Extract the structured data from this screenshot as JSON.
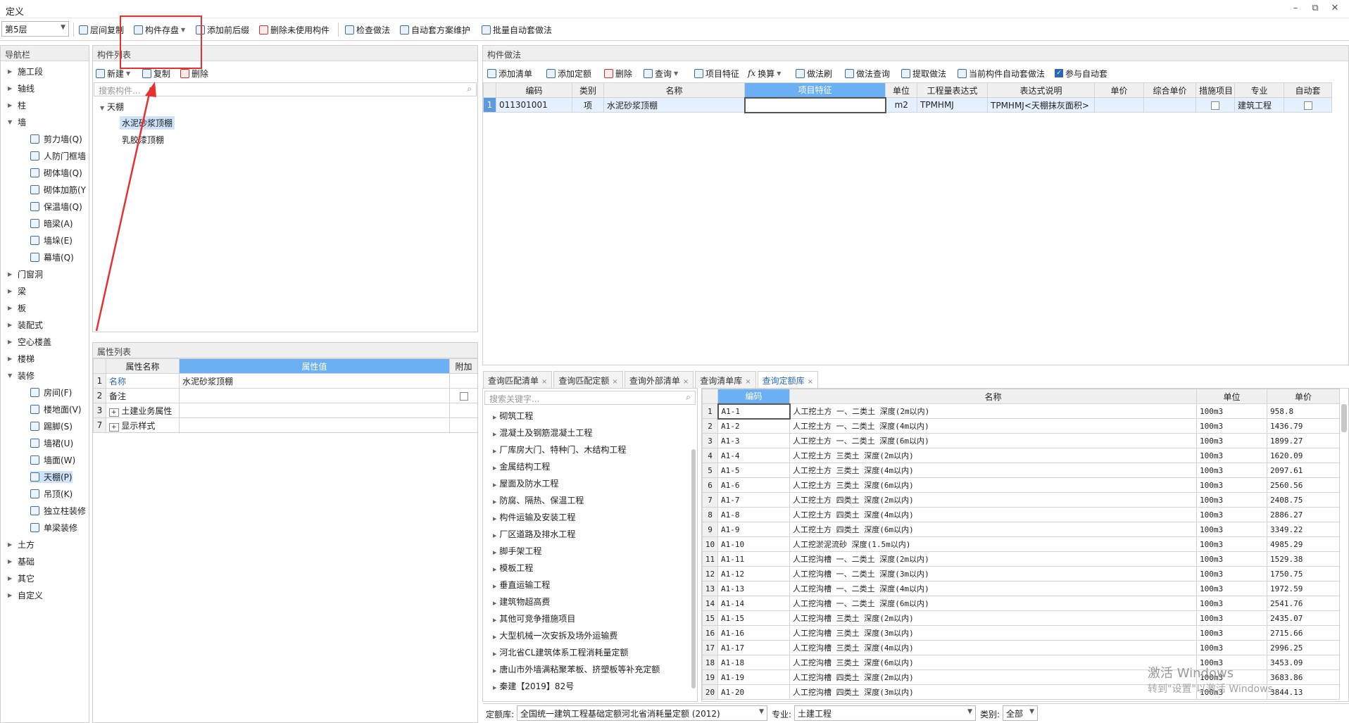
{
  "window": {
    "title": "定义"
  },
  "toolbar": {
    "floor": "第5层",
    "buttons": [
      "层间复制",
      "构件存盘",
      "添加前后缀",
      "删除未使用构件",
      "检查做法",
      "自动套方案维护",
      "批量自动套做法"
    ]
  },
  "nav": {
    "title": "导航栏",
    "items": [
      {
        "label": "施工段",
        "level": 0,
        "expanded": false
      },
      {
        "label": "轴线",
        "level": 0,
        "expanded": false
      },
      {
        "label": "柱",
        "level": 0,
        "expanded": false
      },
      {
        "label": "墙",
        "level": 0,
        "expanded": true
      },
      {
        "label": "剪力墙(Q)",
        "level": 1
      },
      {
        "label": "人防门框墙",
        "level": 1
      },
      {
        "label": "砌体墙(Q)",
        "level": 1
      },
      {
        "label": "砌体加筋(Y",
        "level": 1
      },
      {
        "label": "保温墙(Q)",
        "level": 1
      },
      {
        "label": "暗梁(A)",
        "level": 1
      },
      {
        "label": "墙垛(E)",
        "level": 1
      },
      {
        "label": "幕墙(Q)",
        "level": 1
      },
      {
        "label": "门窗洞",
        "level": 0,
        "expanded": false
      },
      {
        "label": "梁",
        "level": 0,
        "expanded": false
      },
      {
        "label": "板",
        "level": 0,
        "expanded": false
      },
      {
        "label": "装配式",
        "level": 0,
        "expanded": false
      },
      {
        "label": "空心楼盖",
        "level": 0,
        "expanded": false
      },
      {
        "label": "楼梯",
        "level": 0,
        "expanded": false
      },
      {
        "label": "装修",
        "level": 0,
        "expanded": true
      },
      {
        "label": "房间(F)",
        "level": 1
      },
      {
        "label": "楼地面(V)",
        "level": 1
      },
      {
        "label": "踢脚(S)",
        "level": 1
      },
      {
        "label": "墙裙(U)",
        "level": 1
      },
      {
        "label": "墙面(W)",
        "level": 1
      },
      {
        "label": "天棚(P)",
        "level": 1,
        "selected": true
      },
      {
        "label": "吊顶(K)",
        "level": 1
      },
      {
        "label": "独立柱装修",
        "level": 1
      },
      {
        "label": "单梁装修",
        "level": 1
      },
      {
        "label": "土方",
        "level": 0,
        "expanded": false
      },
      {
        "label": "基础",
        "level": 0,
        "expanded": false
      },
      {
        "label": "其它",
        "level": 0,
        "expanded": false
      },
      {
        "label": "自定义",
        "level": 0,
        "expanded": false
      }
    ]
  },
  "component_list": {
    "title": "构件列表",
    "actions": [
      "新建",
      "复制",
      "删除"
    ],
    "search_placeholder": "搜索构件...",
    "group": "天棚",
    "items": [
      "水泥砂浆顶棚",
      "乳胶漆顶棚"
    ]
  },
  "properties": {
    "title": "属性列表",
    "headers": [
      "属性名称",
      "属性值",
      "附加"
    ],
    "rows": [
      {
        "no": "1",
        "name": "名称",
        "value": "水泥砂浆顶棚"
      },
      {
        "no": "2",
        "name": "备注",
        "value": ""
      },
      {
        "no": "3",
        "name": "土建业务属性",
        "value": ""
      },
      {
        "no": "7",
        "name": "显示样式",
        "value": ""
      }
    ]
  },
  "method": {
    "title": "构件做法",
    "actions": [
      "添加清单",
      "添加定额",
      "删除",
      "查询",
      "项目特征",
      "换算",
      "做法刷",
      "做法查询",
      "提取做法",
      "当前构件自动套做法",
      "参与自动套"
    ],
    "headers": [
      "编码",
      "类别",
      "名称",
      "项目特征",
      "单位",
      "工程量表达式",
      "表达式说明",
      "单价",
      "综合单价",
      "措施项目",
      "专业",
      "自动套"
    ],
    "rows": [
      {
        "no": "1",
        "code": "011301001",
        "cat": "项",
        "name": "水泥砂浆顶棚",
        "feature": "",
        "unit": "m2",
        "expr": "TPMHMJ",
        "desc": "TPMHMJ<天棚抹灰面积>",
        "price": "",
        "total": "",
        "specialty": "建筑工程"
      }
    ]
  },
  "query": {
    "tabs": [
      "查询匹配清单",
      "查询匹配定额",
      "查询外部清单",
      "查询清单库",
      "查询定额库"
    ],
    "search_placeholder": "搜索关键字...",
    "categories": [
      "砌筑工程",
      "混凝土及钢筋混凝土工程",
      "厂库房大门、特种门、木结构工程",
      "金属结构工程",
      "屋面及防水工程",
      "防腐、隔热、保温工程",
      "构件运输及安装工程",
      "厂区道路及排水工程",
      "脚手架工程",
      "模板工程",
      "垂直运输工程",
      "建筑物超高费",
      "其他可竞争措施项目",
      "大型机械一次安拆及场外运输费",
      "河北省CL建筑体系工程消耗量定额",
      "唐山市外墙满粘聚苯板、挤塑板等补充定额",
      "秦建【2019】82号"
    ],
    "headers": [
      "编码",
      "名称",
      "单位",
      "单价"
    ],
    "rows": [
      {
        "no": "1",
        "code": "A1-1",
        "name": "人工挖土方 一、二类土 深度(2m以内)",
        "unit": "100m3",
        "price": "958.8"
      },
      {
        "no": "2",
        "code": "A1-2",
        "name": "人工挖土方 一、二类土 深度(4m以内)",
        "unit": "100m3",
        "price": "1436.79"
      },
      {
        "no": "3",
        "code": "A1-3",
        "name": "人工挖土方 一、二类土 深度(6m以内)",
        "unit": "100m3",
        "price": "1899.27"
      },
      {
        "no": "4",
        "code": "A1-4",
        "name": "人工挖土方 三类土 深度(2m以内)",
        "unit": "100m3",
        "price": "1620.09"
      },
      {
        "no": "5",
        "code": "A1-5",
        "name": "人工挖土方 三类土 深度(4m以内)",
        "unit": "100m3",
        "price": "2097.61"
      },
      {
        "no": "6",
        "code": "A1-6",
        "name": "人工挖土方 三类土 深度(6m以内)",
        "unit": "100m3",
        "price": "2560.56"
      },
      {
        "no": "7",
        "code": "A1-7",
        "name": "人工挖土方 四类土 深度(2m以内)",
        "unit": "100m3",
        "price": "2408.75"
      },
      {
        "no": "8",
        "code": "A1-8",
        "name": "人工挖土方 四类土 深度(4m以内)",
        "unit": "100m3",
        "price": "2886.27"
      },
      {
        "no": "9",
        "code": "A1-9",
        "name": "人工挖土方 四类土 深度(6m以内)",
        "unit": "100m3",
        "price": "3349.22"
      },
      {
        "no": "10",
        "code": "A1-10",
        "name": "人工挖淤泥流砂 深度(1.5m以内)",
        "unit": "100m3",
        "price": "4985.29"
      },
      {
        "no": "11",
        "code": "A1-11",
        "name": "人工挖沟槽 一、二类土 深度(2m以内)",
        "unit": "100m3",
        "price": "1529.38"
      },
      {
        "no": "12",
        "code": "A1-12",
        "name": "人工挖沟槽 一、二类土 深度(3m以内)",
        "unit": "100m3",
        "price": "1750.75"
      },
      {
        "no": "13",
        "code": "A1-13",
        "name": "人工挖沟槽 一、二类土 深度(4m以内)",
        "unit": "100m3",
        "price": "1972.59"
      },
      {
        "no": "14",
        "code": "A1-14",
        "name": "人工挖沟槽 一、二类土 深度(6m以内)",
        "unit": "100m3",
        "price": "2541.76"
      },
      {
        "no": "15",
        "code": "A1-15",
        "name": "人工挖沟槽 三类土 深度(2m以内)",
        "unit": "100m3",
        "price": "2435.07"
      },
      {
        "no": "16",
        "code": "A1-16",
        "name": "人工挖沟槽 三类土 深度(3m以内)",
        "unit": "100m3",
        "price": "2715.66"
      },
      {
        "no": "17",
        "code": "A1-17",
        "name": "人工挖沟槽 三类土 深度(4m以内)",
        "unit": "100m3",
        "price": "2996.25"
      },
      {
        "no": "18",
        "code": "A1-18",
        "name": "人工挖沟槽 三类土 深度(6m以内)",
        "unit": "100m3",
        "price": "3453.09"
      },
      {
        "no": "19",
        "code": "A1-19",
        "name": "人工挖沟槽 四类土 深度(2m以内)",
        "unit": "100m3",
        "price": "3683.86"
      },
      {
        "no": "20",
        "code": "A1-20",
        "name": "人工挖沟槽 四类土 深度(3m以内)",
        "unit": "100m3",
        "price": "3844.13"
      }
    ],
    "footer": {
      "quota_label": "定额库:",
      "quota_value": "全国统一建筑工程基础定额河北省消耗量定额 (2012)",
      "spec_label": "专业:",
      "spec_value": "土建工程",
      "cat_label": "类别:",
      "cat_value": "全部"
    }
  },
  "watermark": {
    "line1": "激活 Windows",
    "line2": "转到\"设置\"以激活 Windows"
  }
}
